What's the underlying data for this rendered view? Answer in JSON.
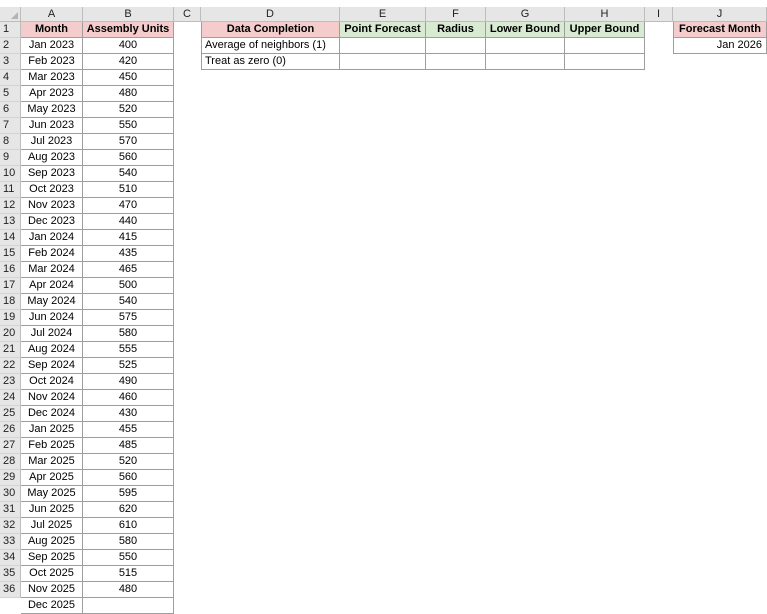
{
  "sheet": {
    "columns": [
      "A",
      "B",
      "C",
      "D",
      "E",
      "F",
      "G",
      "H",
      "I",
      "J"
    ],
    "rows": [
      "1",
      "2",
      "3",
      "4",
      "5",
      "6",
      "7",
      "8",
      "9",
      "10",
      "11",
      "12",
      "13",
      "14",
      "15",
      "16",
      "17",
      "18",
      "19",
      "20",
      "21",
      "22",
      "23",
      "24",
      "25",
      "26",
      "27",
      "28",
      "29",
      "30",
      "31",
      "32",
      "33",
      "34",
      "35",
      "36"
    ]
  },
  "data_table": {
    "headers": {
      "month": "Month",
      "units": "Assembly Units"
    },
    "months": [
      "Jan 2023",
      "Feb 2023",
      "Mar 2023",
      "Apr 2023",
      "May 2023",
      "Jun 2023",
      "Jul 2023",
      "Aug 2023",
      "Sep 2023",
      "Oct 2023",
      "Nov 2023",
      "Dec 2023",
      "Jan 2024",
      "Feb 2024",
      "Mar 2024",
      "Apr 2024",
      "May 2024",
      "Jun 2024",
      "Jul 2024",
      "Aug 2024",
      "Sep 2024",
      "Oct 2024",
      "Nov 2024",
      "Dec 2024",
      "Jan 2025",
      "Feb 2025",
      "Mar 2025",
      "Apr 2025",
      "May 2025",
      "Jun 2025",
      "Jul 2025",
      "Aug 2025",
      "Sep 2025",
      "Oct 2025",
      "Nov 2025",
      "Dec 2025"
    ],
    "units": [
      "400",
      "420",
      "450",
      "480",
      "520",
      "550",
      "570",
      "560",
      "540",
      "510",
      "470",
      "440",
      "415",
      "435",
      "465",
      "500",
      "540",
      "575",
      "580",
      "555",
      "525",
      "490",
      "460",
      "430",
      "455",
      "485",
      "520",
      "560",
      "595",
      "620",
      "610",
      "580",
      "550",
      "515",
      "480"
    ]
  },
  "forecast_table": {
    "headers": {
      "data_completion": "Data Completion",
      "point_forecast": "Point Forecast",
      "radius": "Radius",
      "lower_bound": "Lower Bound",
      "upper_bound": "Upper Bound"
    },
    "rows": [
      {
        "label": "Average of neighbors (1)",
        "point_forecast": "",
        "radius": "",
        "lower_bound": "",
        "upper_bound": ""
      },
      {
        "label": "Treat as zero (0)",
        "point_forecast": "",
        "radius": "",
        "lower_bound": "",
        "upper_bound": ""
      }
    ]
  },
  "forecast_month": {
    "header": "Forecast Month",
    "value": "Jan 2026"
  },
  "colors": {
    "header_pink": "#f4cccc",
    "header_green": "#d9ead3",
    "grid_header_bg": "#e6e6e6"
  }
}
